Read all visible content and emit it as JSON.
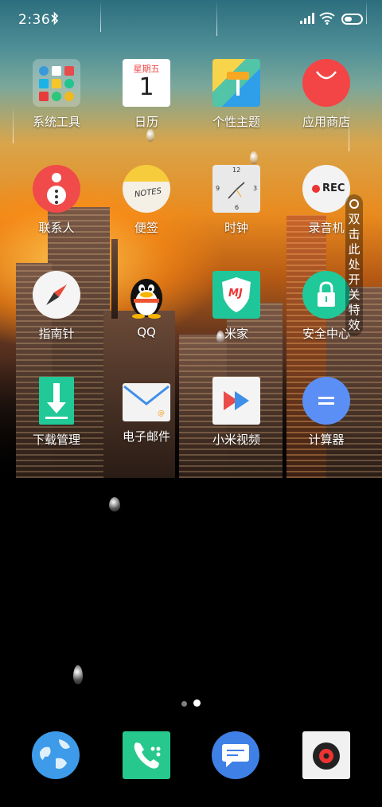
{
  "status_bar": {
    "time": "2:36"
  },
  "apps": [
    {
      "label": "系统工具"
    },
    {
      "label": "日历",
      "weekday": "星期五",
      "day": "1"
    },
    {
      "label": "个性主题"
    },
    {
      "label": "应用商店"
    },
    {
      "label": "联系人"
    },
    {
      "label": "便签",
      "note_text": "NOTES"
    },
    {
      "label": "时钟",
      "n12": "12",
      "n3": "3",
      "n6": "6",
      "n9": "9"
    },
    {
      "label": "录音机",
      "rec_text": "REC"
    },
    {
      "label": "指南针"
    },
    {
      "label": "QQ"
    },
    {
      "label": "米家",
      "badge": "MJ"
    },
    {
      "label": "安全中心"
    },
    {
      "label": "下载管理"
    },
    {
      "label": "电子邮件"
    },
    {
      "label": "小米视频"
    },
    {
      "label": "计算器"
    }
  ],
  "side_tip": {
    "chars": [
      "双",
      "击",
      "此",
      "处",
      "开",
      "关",
      "特",
      "效"
    ]
  },
  "page_indicator": {
    "count": 2,
    "active": 2
  },
  "dock": [
    {
      "name": "browser"
    },
    {
      "name": "phone"
    },
    {
      "name": "messages"
    },
    {
      "name": "camera"
    }
  ],
  "colors": {
    "contacts": "#f04a4a",
    "app_store": "#f34545",
    "security": "#1fc99a",
    "calculator": "#5b8ff5",
    "download": "#20c997",
    "phone": "#27c88d",
    "messages": "#3f80e6",
    "browser": "#3d9be9"
  }
}
